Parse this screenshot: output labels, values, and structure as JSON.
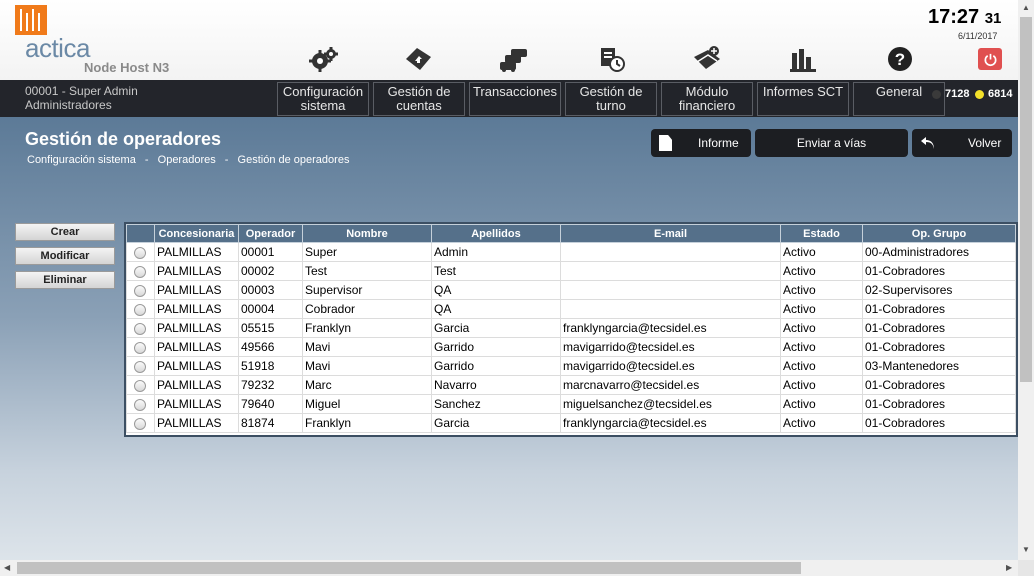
{
  "header": {
    "logo_text": "actica",
    "node_host": "Node Host N3",
    "clock_hm": "17:27",
    "clock_sec": "31",
    "date": "6/11/2017"
  },
  "user": {
    "id_name": "00001 - Super Admin",
    "role": "Administradores"
  },
  "menu": [
    {
      "line1": "Configuración",
      "line2": "sistema"
    },
    {
      "line1": "Gestión de",
      "line2": "cuentas"
    },
    {
      "line1": "Transacciones",
      "line2": ""
    },
    {
      "line1": "Gestión de",
      "line2": "turno"
    },
    {
      "line1": "Módulo",
      "line2": "financiero"
    },
    {
      "line1": "Informes SCT",
      "line2": ""
    },
    {
      "line1": "General",
      "line2": ""
    }
  ],
  "status": {
    "count1": "7128",
    "count2": "6814",
    "dot1_color": "#3a3a3a",
    "dot2_color": "#f2e02a"
  },
  "page": {
    "title": "Gestión de operadores",
    "breadcrumb": [
      "Configuración sistema",
      "-",
      "Operadores",
      "-",
      "Gestión de operadores"
    ]
  },
  "actions": {
    "informe": "Informe",
    "enviar": "Enviar a vías",
    "volver": "Volver"
  },
  "side_actions": {
    "crear": "Crear",
    "modificar": "Modificar",
    "eliminar": "Eliminar"
  },
  "table": {
    "columns": [
      "",
      "Concesionaria",
      "Operador",
      "Nombre",
      "Apellidos",
      "E-mail",
      "Estado",
      "Op. Grupo"
    ],
    "rows": [
      [
        "PALMILLAS",
        "00001",
        "Super",
        "Admin",
        "",
        "Activo",
        "00-Administradores"
      ],
      [
        "PALMILLAS",
        "00002",
        "Test",
        "Test",
        "",
        "Activo",
        "01-Cobradores"
      ],
      [
        "PALMILLAS",
        "00003",
        "Supervisor",
        "QA",
        "",
        "Activo",
        "02-Supervisores"
      ],
      [
        "PALMILLAS",
        "00004",
        "Cobrador",
        "QA",
        "",
        "Activo",
        "01-Cobradores"
      ],
      [
        "PALMILLAS",
        "05515",
        "Franklyn",
        "Garcia",
        "franklyngarcia@tecsidel.es",
        "Activo",
        "01-Cobradores"
      ],
      [
        "PALMILLAS",
        "49566",
        "Mavi",
        "Garrido",
        "mavigarrido@tecsidel.es",
        "Activo",
        "01-Cobradores"
      ],
      [
        "PALMILLAS",
        "51918",
        "Mavi",
        "Garrido",
        "mavigarrido@tecsidel.es",
        "Activo",
        "03-Mantenedores"
      ],
      [
        "PALMILLAS",
        "79232",
        "Marc",
        "Navarro",
        "marcnavarro@tecsidel.es",
        "Activo",
        "01-Cobradores"
      ],
      [
        "PALMILLAS",
        "79640",
        "Miguel",
        "Sanchez",
        "miguelsanchez@tecsidel.es",
        "Activo",
        "01-Cobradores"
      ],
      [
        "PALMILLAS",
        "81874",
        "Franklyn",
        "Garcia",
        "franklyngarcia@tecsidel.es",
        "Activo",
        "01-Cobradores"
      ]
    ]
  },
  "icons": [
    "gear-icon",
    "card-arrow-icon",
    "cars-icon",
    "schedule-icon",
    "wallet-icon",
    "bar-chart-icon",
    "help-icon",
    "power-icon",
    "document-icon",
    "back-arrow-icon"
  ]
}
